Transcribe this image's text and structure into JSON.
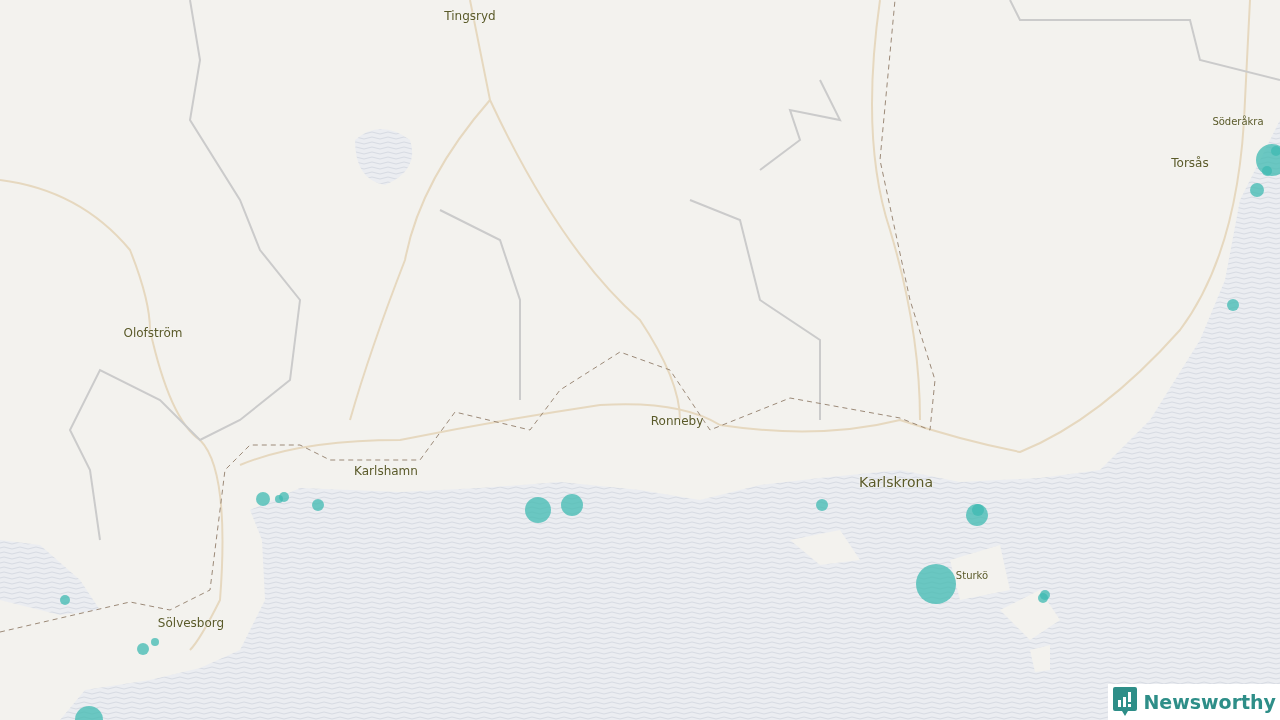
{
  "map": {
    "places": [
      {
        "name": "Tingsryd",
        "kind": "town"
      },
      {
        "name": "Söderåkra",
        "kind": "village"
      },
      {
        "name": "Torsås",
        "kind": "town"
      },
      {
        "name": "Olofström",
        "kind": "town"
      },
      {
        "name": "Ronneby",
        "kind": "town"
      },
      {
        "name": "Karlshamn",
        "kind": "town"
      },
      {
        "name": "Karlskrona",
        "kind": "city"
      },
      {
        "name": "Sturkö",
        "kind": "village"
      },
      {
        "name": "Sölvesborg",
        "kind": "town"
      }
    ]
  },
  "brand": {
    "name": "Newsworthy"
  }
}
